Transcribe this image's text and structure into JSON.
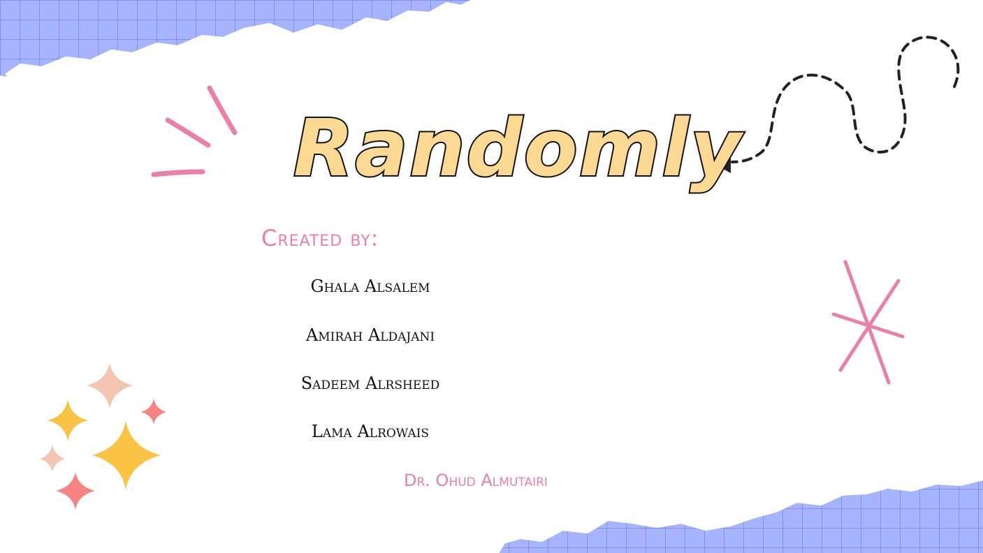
{
  "slide": {
    "title": "Randomly",
    "created_by_label": "Created by:",
    "members": [
      "Ghala Alsalem",
      "Amirah Aldajani",
      "Sadeem Alrsheed",
      "Lama Alrowais"
    ],
    "supervisor": "Dr. Ohud Almutairi"
  },
  "colors": {
    "title_fill": "#fcd993",
    "accent_pink": "#ec7fa6",
    "grid_paper": "#a5b4fc",
    "grid_line": "#7b7ff0",
    "sparkle_yellow": "#fbc343",
    "sparkle_peach": "#f4c5b0",
    "sparkle_coral": "#f78483"
  },
  "decorations": [
    "grid-paper-top-left",
    "grid-paper-bottom-right",
    "pink-burst-lines",
    "dashed-arrow",
    "pink-asterisk",
    "sparkles-cluster"
  ]
}
